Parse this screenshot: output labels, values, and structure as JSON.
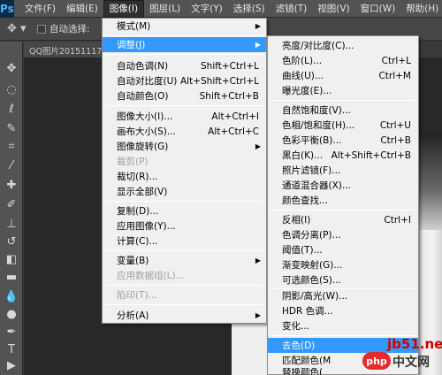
{
  "app": {
    "logo": "Ps"
  },
  "menubar": {
    "items": [
      "文件(F)",
      "编辑(E)",
      "图像(I)",
      "图层(L)",
      "文字(Y)",
      "选择(S)",
      "滤镜(T)",
      "视图(V)",
      "窗口(W)",
      "帮助(H)"
    ],
    "active": "图像(I)"
  },
  "options_bar": {
    "tool_icon": "move-tool-icon",
    "auto_select_label": "自动选择:",
    "auto_select_checked": false
  },
  "document": {
    "tab_title": "QQ图片20151117"
  },
  "image_menu": {
    "items": [
      {
        "label": "模式(M)",
        "shortcut": "",
        "submenu": true,
        "disabled": false
      },
      {
        "label": "调整(J)",
        "shortcut": "",
        "submenu": true,
        "disabled": false,
        "highlighted": true
      },
      {
        "label": "自动色调(N)",
        "shortcut": "Shift+Ctrl+L"
      },
      {
        "label": "自动对比度(U)",
        "shortcut": "Alt+Shift+Ctrl+L"
      },
      {
        "label": "自动颜色(O)",
        "shortcut": "Shift+Ctrl+B"
      },
      {
        "label": "图像大小(I)...",
        "shortcut": "Alt+Ctrl+I"
      },
      {
        "label": "画布大小(S)...",
        "shortcut": "Alt+Ctrl+C"
      },
      {
        "label": "图像旋转(G)",
        "shortcut": "",
        "submenu": true
      },
      {
        "label": "裁剪(P)",
        "shortcut": "",
        "disabled": true
      },
      {
        "label": "裁切(R)...",
        "shortcut": ""
      },
      {
        "label": "显示全部(V)",
        "shortcut": ""
      },
      {
        "label": "复制(D)...",
        "shortcut": ""
      },
      {
        "label": "应用图像(Y)...",
        "shortcut": ""
      },
      {
        "label": "计算(C)...",
        "shortcut": ""
      },
      {
        "label": "变量(B)",
        "shortcut": "",
        "submenu": true
      },
      {
        "label": "应用数据组(L)...",
        "shortcut": "",
        "disabled": true
      },
      {
        "label": "陷印(T)...",
        "shortcut": "",
        "disabled": true
      },
      {
        "label": "分析(A)",
        "shortcut": "",
        "submenu": true
      }
    ]
  },
  "adjust_menu": {
    "items": [
      {
        "label": "亮度/对比度(C)...",
        "shortcut": ""
      },
      {
        "label": "色阶(L)...",
        "shortcut": "Ctrl+L"
      },
      {
        "label": "曲线(U)...",
        "shortcut": "Ctrl+M"
      },
      {
        "label": "曝光度(E)...",
        "shortcut": ""
      },
      {
        "label": "自然饱和度(V)...",
        "shortcut": ""
      },
      {
        "label": "色相/饱和度(H)...",
        "shortcut": "Ctrl+U"
      },
      {
        "label": "色彩平衡(B)...",
        "shortcut": "Ctrl+B"
      },
      {
        "label": "黑白(K)...",
        "shortcut": "Alt+Shift+Ctrl+B"
      },
      {
        "label": "照片滤镜(F)...",
        "shortcut": ""
      },
      {
        "label": "通道混合器(X)...",
        "shortcut": ""
      },
      {
        "label": "颜色查找...",
        "shortcut": ""
      },
      {
        "label": "反相(I)",
        "shortcut": "Ctrl+I"
      },
      {
        "label": "色调分离(P)...",
        "shortcut": ""
      },
      {
        "label": "阈值(T)...",
        "shortcut": ""
      },
      {
        "label": "渐变映射(G)...",
        "shortcut": ""
      },
      {
        "label": "可选颜色(S)...",
        "shortcut": ""
      },
      {
        "label": "阴影/高光(W)...",
        "shortcut": ""
      },
      {
        "label": "HDR 色调...",
        "shortcut": ""
      },
      {
        "label": "变化...",
        "shortcut": ""
      },
      {
        "label": "去色(D)",
        "shortcut": ""
      },
      {
        "label": "匹配颜色(M",
        "shortcut": ""
      },
      {
        "label": "替换颜色(",
        "shortcut": ""
      }
    ]
  },
  "watermark": {
    "site": "jb51.net",
    "badge": "php",
    "text": "中文网",
    "sub": "家"
  }
}
